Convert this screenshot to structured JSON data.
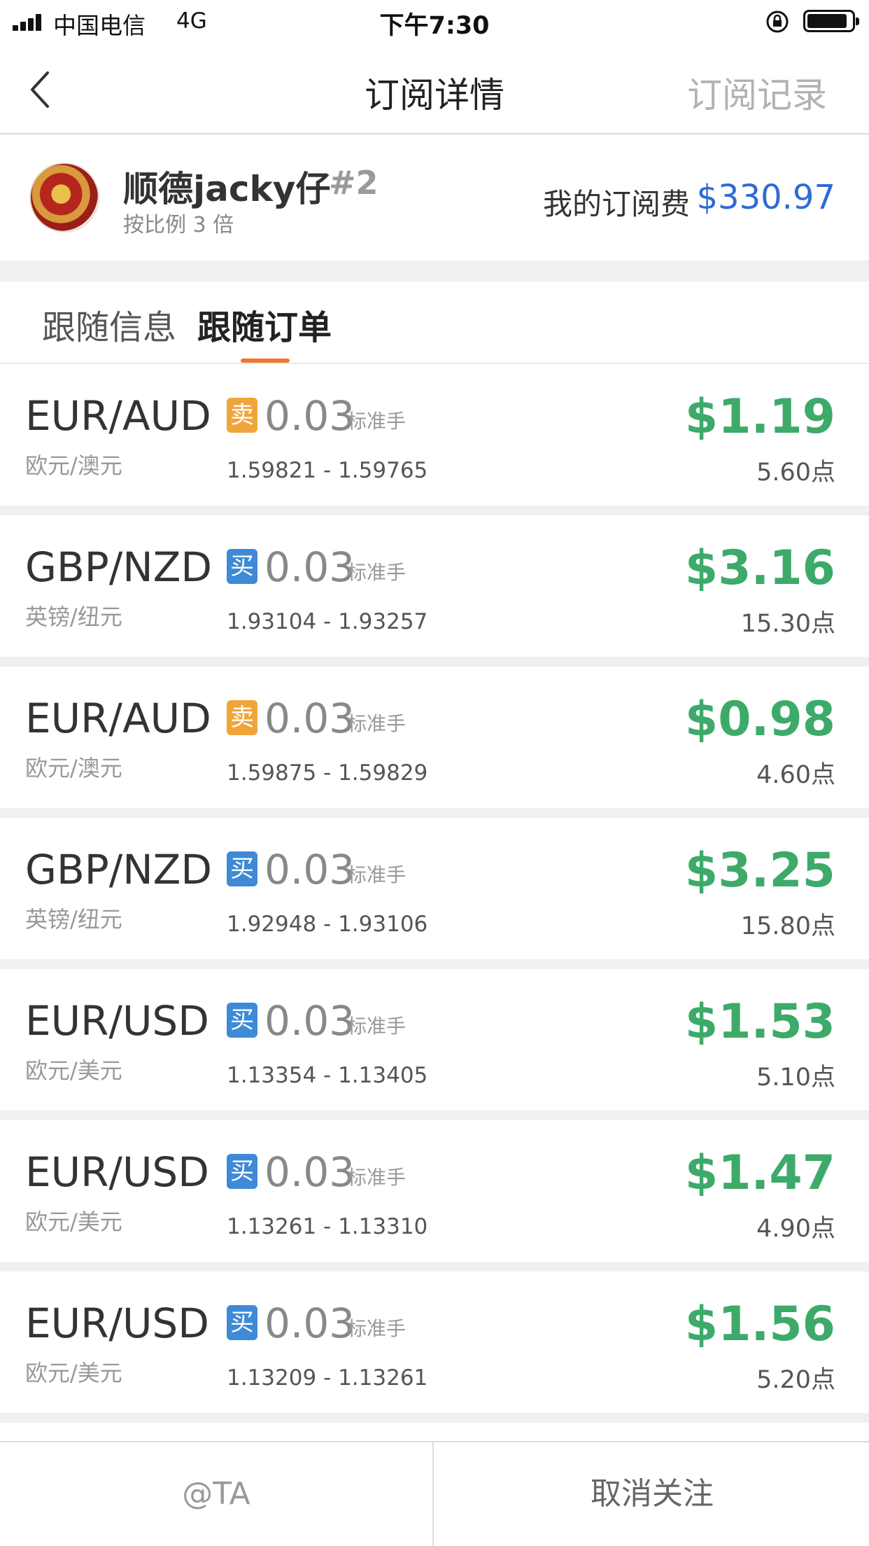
{
  "status_bar": {
    "carrier": "中国电信",
    "network": "4G",
    "time": "下午7:30",
    "icons": [
      "signal-icon",
      "orientation-lock-icon",
      "battery-icon"
    ]
  },
  "nav": {
    "back_icon": "chevron-left-icon",
    "title": "订阅详情",
    "right_action": "订阅记录"
  },
  "profile": {
    "name": "顺德jacky仔",
    "rank": "#2",
    "ratio_text": "按比例 3 倍",
    "fee_label": "我的订阅费",
    "fee_value": "$330.97",
    "fee_color": "#2f6bd6"
  },
  "tabs": [
    {
      "label": "跟随信息",
      "active": false
    },
    {
      "label": "跟随订单",
      "active": true
    }
  ],
  "accent_color": "#f07530",
  "orders": [
    {
      "pair": "EUR/AUD",
      "pair_cn": "欧元/澳元",
      "direction": "卖",
      "direction_type": "sell",
      "lots": "0.03",
      "unit": "标准手",
      "range": "1.59821 - 1.59765",
      "profit": "$1.19",
      "points": "5.60点"
    },
    {
      "pair": "GBP/NZD",
      "pair_cn": "英镑/纽元",
      "direction": "买",
      "direction_type": "buy",
      "lots": "0.03",
      "unit": "标准手",
      "range": "1.93104 - 1.93257",
      "profit": "$3.16",
      "points": "15.30点"
    },
    {
      "pair": "EUR/AUD",
      "pair_cn": "欧元/澳元",
      "direction": "卖",
      "direction_type": "sell",
      "lots": "0.03",
      "unit": "标准手",
      "range": "1.59875 - 1.59829",
      "profit": "$0.98",
      "points": "4.60点"
    },
    {
      "pair": "GBP/NZD",
      "pair_cn": "英镑/纽元",
      "direction": "买",
      "direction_type": "buy",
      "lots": "0.03",
      "unit": "标准手",
      "range": "1.92948 - 1.93106",
      "profit": "$3.25",
      "points": "15.80点"
    },
    {
      "pair": "EUR/USD",
      "pair_cn": "欧元/美元",
      "direction": "买",
      "direction_type": "buy",
      "lots": "0.03",
      "unit": "标准手",
      "range": "1.13354 - 1.13405",
      "profit": "$1.53",
      "points": "5.10点"
    },
    {
      "pair": "EUR/USD",
      "pair_cn": "欧元/美元",
      "direction": "买",
      "direction_type": "buy",
      "lots": "0.03",
      "unit": "标准手",
      "range": "1.13261 - 1.13310",
      "profit": "$1.47",
      "points": "4.90点"
    },
    {
      "pair": "EUR/USD",
      "pair_cn": "欧元/美元",
      "direction": "买",
      "direction_type": "buy",
      "lots": "0.03",
      "unit": "标准手",
      "range": "1.13209 - 1.13261",
      "profit": "$1.56",
      "points": "5.20点"
    }
  ],
  "colors": {
    "profit": "#3daa6a",
    "sell": "#f0a53a",
    "buy": "#3e8ad6"
  },
  "bottom": {
    "at_label": "@TA",
    "unfollow_label": "取消关注"
  }
}
